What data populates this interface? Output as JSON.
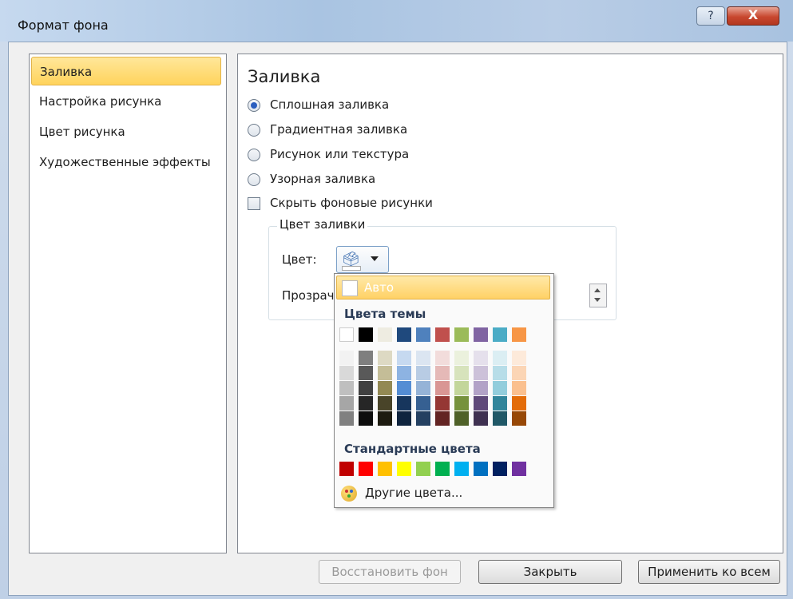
{
  "window": {
    "title": "Формат фона",
    "help_label": "?",
    "close_label": "X"
  },
  "sidebar": {
    "items": [
      {
        "label": "Заливка",
        "selected": true
      },
      {
        "label": "Настройка рисунка",
        "selected": false
      },
      {
        "label": "Цвет рисунка",
        "selected": false
      },
      {
        "label": "Художественные эффекты",
        "selected": false
      }
    ]
  },
  "main": {
    "title": "Заливка",
    "options": [
      {
        "label": "Сплошная заливка",
        "checked": true
      },
      {
        "label": "Градиентная заливка",
        "checked": false
      },
      {
        "label": "Рисунок или текстура",
        "checked": false
      },
      {
        "label": "Узорная заливка",
        "checked": false
      }
    ],
    "hide_background": {
      "label": "Скрыть фоновые рисунки",
      "checked": false
    },
    "fill_color_group": {
      "title": "Цвет заливки",
      "color_label": "Цвет:",
      "transparency_label": "Прозрачность:"
    }
  },
  "color_menu": {
    "auto_label": "Авто",
    "theme_heading": "Цвета темы",
    "theme_base": [
      "#ffffff",
      "#000000",
      "#eeece1",
      "#1f497d",
      "#4f81bd",
      "#c0504d",
      "#9bbb59",
      "#8064a2",
      "#4bacc6",
      "#f79646"
    ],
    "theme_shades": [
      [
        "#f2f2f2",
        "#d9d9d9",
        "#bfbfbf",
        "#a6a6a6",
        "#808080"
      ],
      [
        "#7f7f7f",
        "#595959",
        "#404040",
        "#262626",
        "#0d0d0d"
      ],
      [
        "#ddd9c3",
        "#c4bd97",
        "#938953",
        "#494429",
        "#1d1b10"
      ],
      [
        "#c6d9f0",
        "#8db3e2",
        "#548dd4",
        "#17365d",
        "#0f243e"
      ],
      [
        "#dbe5f1",
        "#b8cce4",
        "#95b3d7",
        "#366092",
        "#244061"
      ],
      [
        "#f2dcdb",
        "#e5b9b7",
        "#d99694",
        "#953734",
        "#632423"
      ],
      [
        "#ebf1dd",
        "#d7e3bc",
        "#c3d69b",
        "#76923c",
        "#4f6128"
      ],
      [
        "#e5e0ec",
        "#ccc1d9",
        "#b2a2c7",
        "#5f497a",
        "#3f3151"
      ],
      [
        "#dbeef3",
        "#b7dde8",
        "#92cddc",
        "#31859b",
        "#205867"
      ],
      [
        "#fdeada",
        "#fbd5b5",
        "#fac08f",
        "#e36c09",
        "#974806"
      ]
    ],
    "standard_heading": "Стандартные цвета",
    "standard_colors": [
      "#c00000",
      "#ff0000",
      "#ffc000",
      "#ffff00",
      "#92d050",
      "#00b050",
      "#00b0f0",
      "#0070c0",
      "#002060",
      "#7030a0"
    ],
    "other_colors_label": "Другие цвета..."
  },
  "buttons": {
    "reset_label": "Восстановить фон",
    "close_label": "Закрыть",
    "apply_all_label": "Применить ко всем"
  }
}
